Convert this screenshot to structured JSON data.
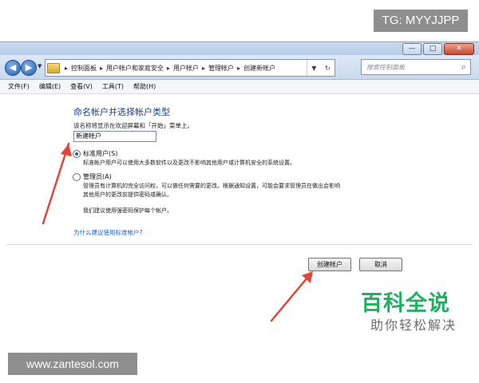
{
  "overlay": {
    "tg_badge": "TG: MYYJJPP",
    "url_badge": "www.zantesol.com",
    "watermark_title": "百科全说",
    "watermark_subtitle": "助你轻松解决"
  },
  "window": {
    "controls": {
      "minimize": "—",
      "maximize": "□",
      "close": "✕"
    },
    "nav": {
      "back": "◀",
      "forward": "▶",
      "dropdown": "▼"
    },
    "breadcrumb": [
      "控制面板",
      "用户帐户和家庭安全",
      "用户帐户",
      "管理帐户",
      "创建新帐户"
    ],
    "breadcrumb_separator": "▸",
    "search_placeholder": "搜索控制面板",
    "menu": [
      "文件(F)",
      "编辑(E)",
      "查看(V)",
      "工具(T)",
      "帮助(H)"
    ]
  },
  "form": {
    "heading": "命名帐户并选择帐户类型",
    "name_hint": "该名称将显示在欢迎屏幕和「开始」菜单上。",
    "name_value": "新建帐户",
    "standard": {
      "label": "标准用户(S)",
      "selected": true,
      "desc": "标准帐户用户可以使用大多数软件以及更改不影响其他用户或计算机安全的系统设置。"
    },
    "admin": {
      "label": "管理员(A)",
      "selected": false,
      "desc_line1": "管理员有计算机的完全访问权，可以做任何需要的更改。根据通知设置，可能会要求管理员在做出会影响",
      "desc_line2": "其他用户的更改前提供密码或确认。"
    },
    "recommend": "我们建议使用强密码保护每个帐户。",
    "help_link": "为什么建议使用标准帐户?",
    "create_button": "创建帐户",
    "cancel_button": "取消"
  },
  "colors": {
    "arrow": "#e0463a",
    "watermark": "#1fb05f",
    "heading": "#1b3d8f",
    "link": "#1d5fc1"
  }
}
